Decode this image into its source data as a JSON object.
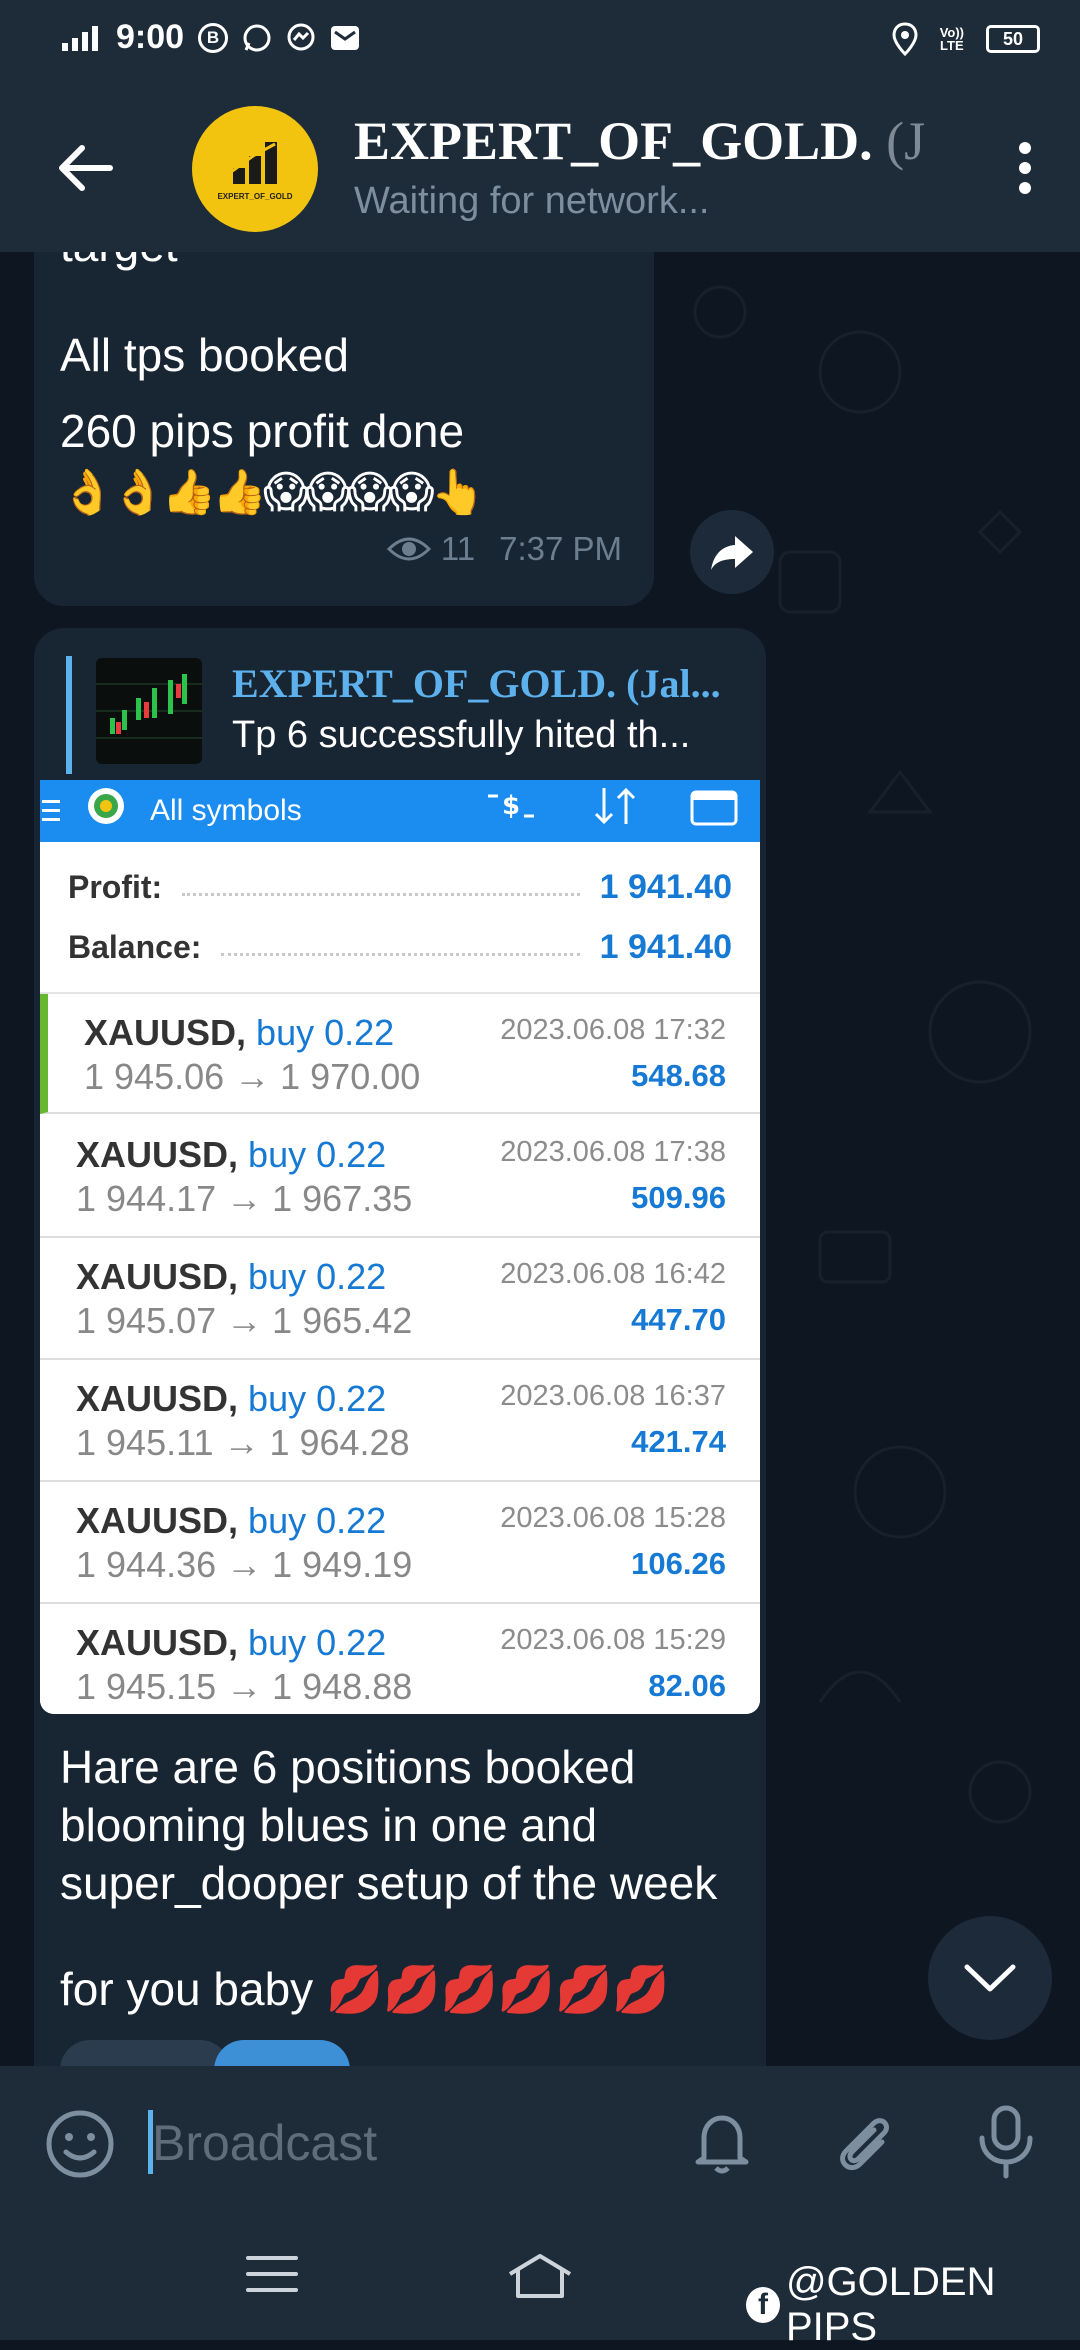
{
  "status_bar": {
    "time": "9:00",
    "battery": "50",
    "volte_top": "Vo))",
    "volte_bottom": "LTE",
    "notif_b": "B"
  },
  "header": {
    "title": "EXPERT_OF_GOLD.",
    "title_faded": " (J",
    "subtitle": "Waiting for network...",
    "avatar_text": "EXPERT_OF_GOLD"
  },
  "message1": {
    "line_partial": "target",
    "line1": "All tps booked",
    "line2": "260 pips profit done",
    "emojis": "👌👌👍👍😱😱😱😱👆",
    "views": "11",
    "time": "7:37 PM"
  },
  "message2": {
    "reply_title": "EXPERT_OF_GOLD. (Jal...",
    "reply_text": "Tp 6 successfully hited th...",
    "screenshot": {
      "top_label": "All symbols",
      "profit_label": "Profit:",
      "profit_value": "1 941.40",
      "balance_label": "Balance:",
      "balance_value": "1 941.40",
      "positions": [
        {
          "symbol": "XAUUSD,",
          "side": "buy 0.22",
          "prices": "1 945.06 → 1 970.00",
          "date": "2023.06.08 17:32",
          "profit": "548.68"
        },
        {
          "symbol": "XAUUSD,",
          "side": "buy 0.22",
          "prices": "1 944.17 → 1 967.35",
          "date": "2023.06.08 17:38",
          "profit": "509.96"
        },
        {
          "symbol": "XAUUSD,",
          "side": "buy 0.22",
          "prices": "1 945.07 → 1 965.42",
          "date": "2023.06.08 16:42",
          "profit": "447.70"
        },
        {
          "symbol": "XAUUSD,",
          "side": "buy 0.22",
          "prices": "1 945.11 → 1 964.28",
          "date": "2023.06.08 16:37",
          "profit": "421.74"
        },
        {
          "symbol": "XAUUSD,",
          "side": "buy 0.22",
          "prices": "1 944.36 → 1 949.19",
          "date": "2023.06.08 15:28",
          "profit": "106.26"
        },
        {
          "symbol": "XAUUSD,",
          "side": "buy 0.22",
          "prices": "1 945.15 → 1 948.88",
          "date": "2023.06.08 15:29",
          "profit": "82.06"
        }
      ]
    },
    "text_line1": "Hare are 6 positions booked",
    "text_line2": "blooming blues in one and",
    "text_line3": "super_dooper setup of the week",
    "text_line4": " for you baby 💋💋💋💋💋💋"
  },
  "input": {
    "placeholder": "Broadcast"
  },
  "watermark": {
    "fb_letter": "f",
    "text": "@GOLDEN PIPS"
  },
  "colors": {
    "background": "#0e1621",
    "bar": "#1e2c3a",
    "bubble": "#182533",
    "accent": "#5db1ec",
    "mt_blue": "#1b8df0"
  }
}
